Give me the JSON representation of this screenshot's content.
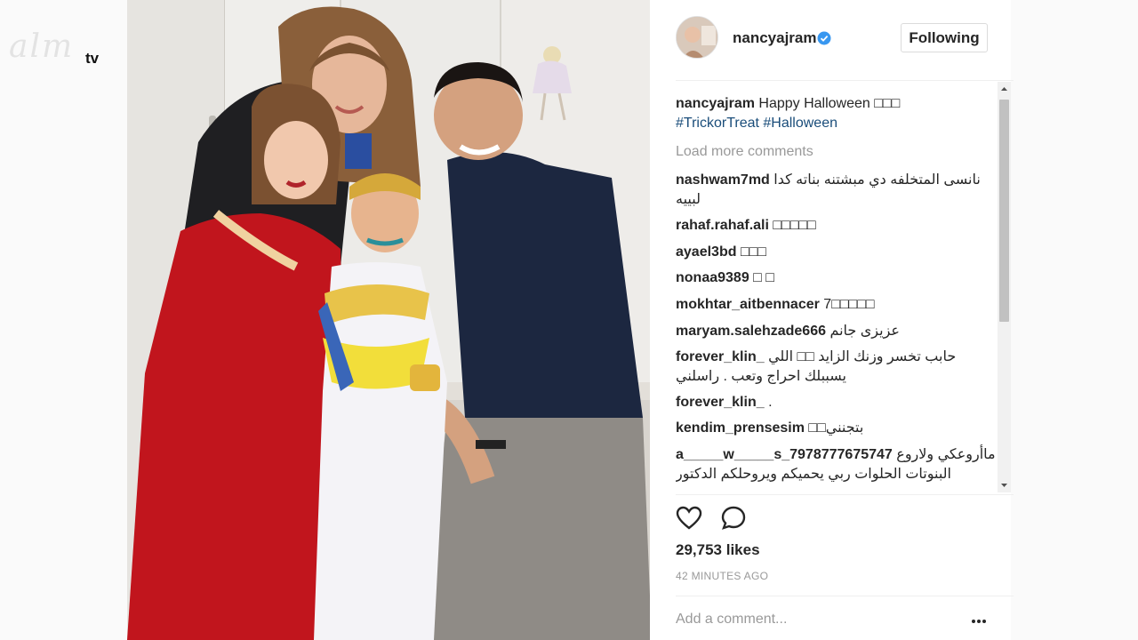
{
  "watermark": {
    "script": "alm",
    "tv": "tv"
  },
  "post": {
    "username": "nancyajram",
    "follow_label": "Following",
    "caption_user": "nancyajram",
    "caption_text": "Happy Halloween",
    "caption_emoji": "□□□",
    "hashtags": [
      "#TrickorTreat",
      "#Halloween"
    ],
    "load_more": "Load more comments",
    "comments": [
      {
        "user": "nashwam7md",
        "text": "نانسى المتخلفه دي مبشتنه بناته كدا لبييه"
      },
      {
        "user": "rahaf.rahaf.ali",
        "text": "□□□□□"
      },
      {
        "user": "ayael3bd",
        "text": "□□□"
      },
      {
        "user": "nonaa9389",
        "text": "□ □"
      },
      {
        "user": "mokhtar_aitbennacer",
        "text": "7□□□□□"
      },
      {
        "user": "maryam.salehzade666",
        "text": "عزيزى جانم"
      },
      {
        "user": "forever_klin_",
        "text": "حابب تخسر وزنك الزايد □□ اللي يسببلك احراج وتعب . راسلني"
      },
      {
        "user": "forever_klin_",
        "text": "."
      },
      {
        "user": "kendim_prensesim",
        "text": "بتجنني□□"
      },
      {
        "user": "a_____w_____s_7978777675747",
        "text": "ماأروعكي ولاروع البنوتات الحلوات ربي يحميكم ويروحلكم الدكتور"
      }
    ],
    "likes": "29,753 likes",
    "timestamp": "42 MINUTES AGO",
    "add_comment_placeholder": "Add a comment...",
    "icons": [
      "heart-icon",
      "comment-icon",
      "more-options-icon",
      "verified-badge-icon"
    ],
    "colors": {
      "accent_link": "#1a4d7a",
      "verified": "#3897f0",
      "muted": "#999999"
    }
  }
}
